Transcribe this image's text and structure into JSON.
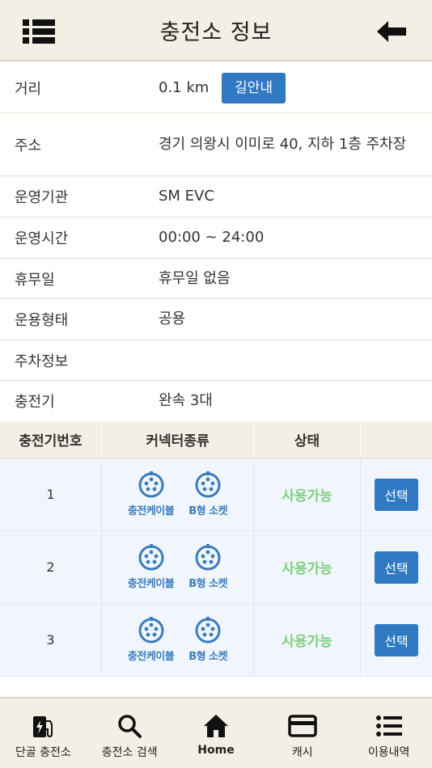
{
  "header": {
    "title": "충전소 정보",
    "menu_icon": "list-menu-icon",
    "back_icon": "arrow-left-icon"
  },
  "info": {
    "rows": [
      {
        "label": "거리",
        "value": "0.1 km",
        "button": "길안내"
      },
      {
        "label": "주소",
        "value": "경기 의왕시 이미로 40, 지하 1층 주차장"
      },
      {
        "label": "운영기관",
        "value": "SM EVC"
      },
      {
        "label": "운영시간",
        "value": "00:00 ~ 24:00"
      },
      {
        "label": "휴무일",
        "value": "휴무일 없음"
      },
      {
        "label": "운용형태",
        "value": "공용"
      },
      {
        "label": "주차정보",
        "value": ""
      },
      {
        "label": "충전기",
        "value": "완속 3대"
      }
    ]
  },
  "table": {
    "headers": [
      "충전기번호",
      "커넥터종류",
      "상태",
      ""
    ],
    "rows": [
      {
        "number": "1",
        "connectors": [
          "충전케이블",
          "B형 소켓"
        ],
        "status": "사용가능",
        "action": "선택"
      },
      {
        "number": "2",
        "connectors": [
          "충전케이블",
          "B형 소켓"
        ],
        "status": "사용가능",
        "action": "선택"
      },
      {
        "number": "3",
        "connectors": [
          "충전케이블",
          "B형 소켓"
        ],
        "status": "사용가능",
        "action": "선택"
      }
    ]
  },
  "nav": [
    {
      "label": "단골 충전소",
      "icon": "charging-station-icon"
    },
    {
      "label": "충전소 검색",
      "icon": "search-icon"
    },
    {
      "label": "Home",
      "icon": "home-icon"
    },
    {
      "label": "캐시",
      "icon": "card-icon"
    },
    {
      "label": "이용내역",
      "icon": "list-icon"
    }
  ],
  "colors": {
    "accent": "#2f7ac2",
    "header_bg": "#f3efe4",
    "status_available": "#7fcf7f",
    "row_bg": "#f0f6fc"
  }
}
